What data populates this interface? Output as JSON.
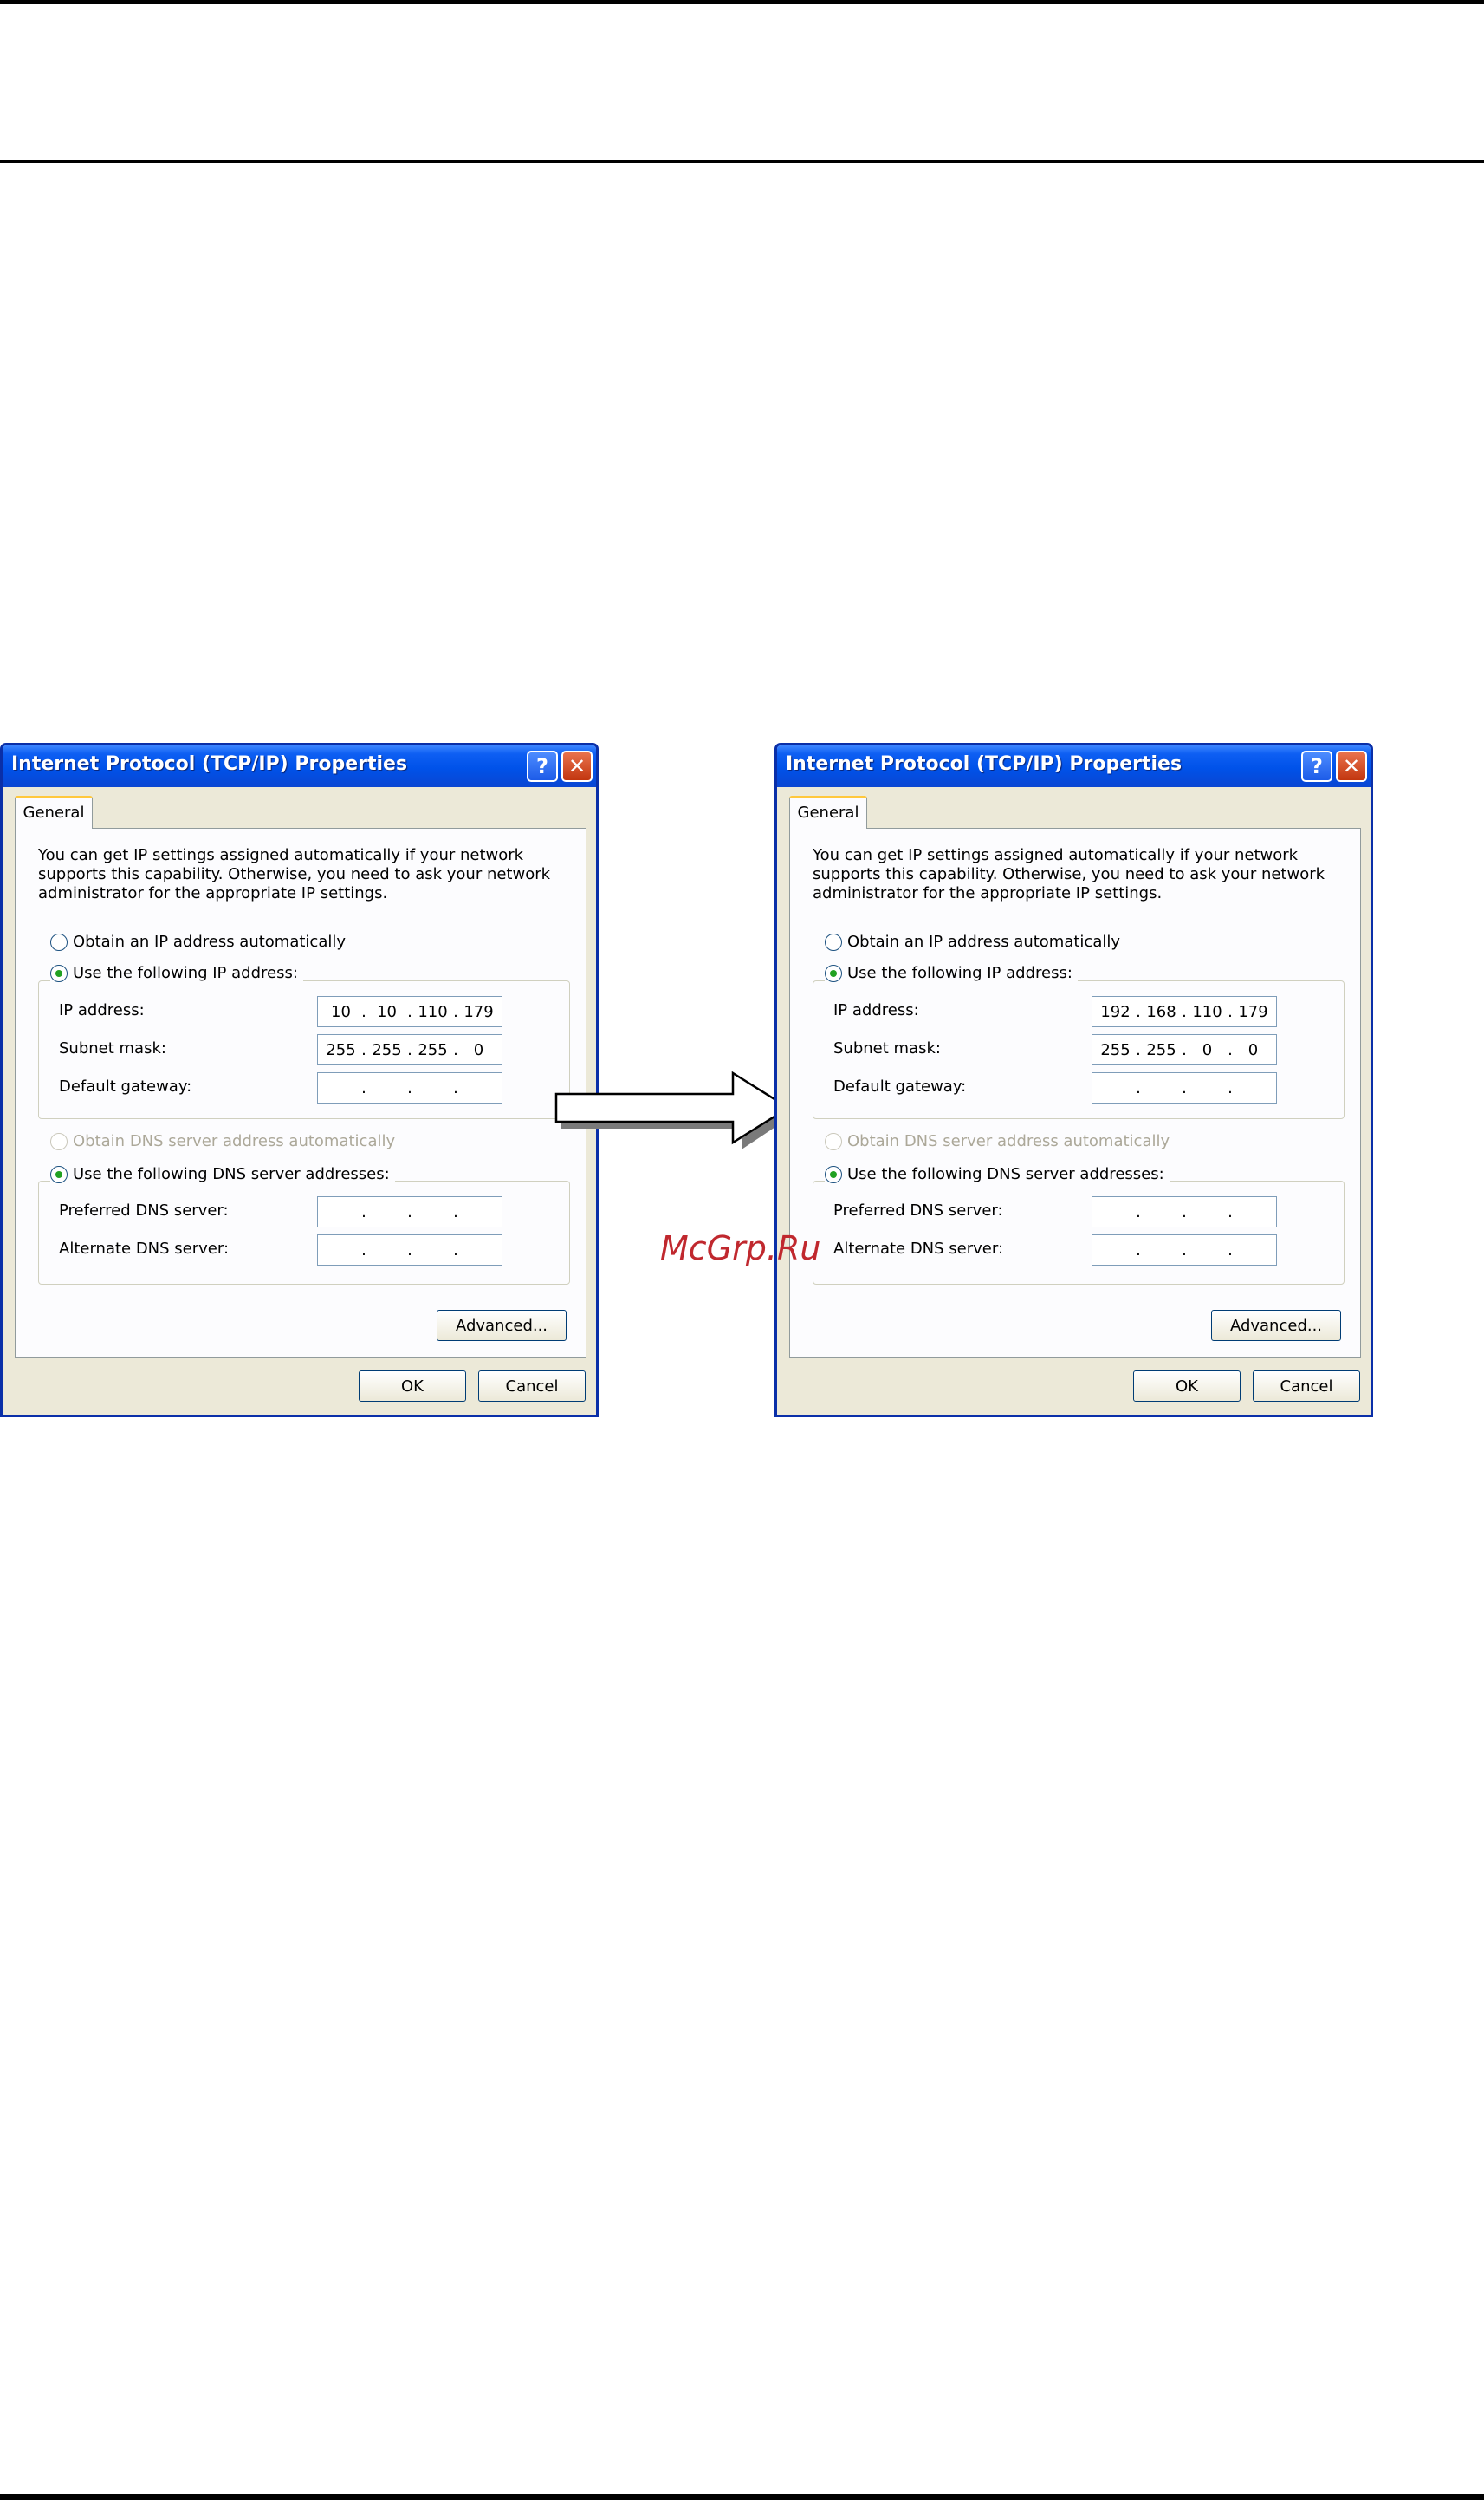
{
  "watermark": "McGrp.Ru",
  "dialogs": [
    {
      "title": "Internet Protocol (TCP/IP) Properties",
      "tab": "General",
      "intro": "You can get IP settings assigned automatically if your network supports this capability. Otherwise, you need to ask your network administrator for the appropriate IP settings.",
      "obtain_ip_auto": "Obtain an IP address automatically",
      "use_following_ip": "Use the following IP address:",
      "ip_address_label": "IP address:",
      "ip_address": [
        "10",
        "10",
        "110",
        "179"
      ],
      "subnet_mask_label": "Subnet mask:",
      "subnet_mask": [
        "255",
        "255",
        "255",
        "0"
      ],
      "default_gateway_label": "Default gateway:",
      "default_gateway": [
        "",
        "",
        "",
        ""
      ],
      "obtain_dns_auto": "Obtain DNS server address automatically",
      "use_following_dns": "Use the following DNS server addresses:",
      "preferred_dns_label": "Preferred DNS server:",
      "preferred_dns": [
        "",
        "",
        "",
        ""
      ],
      "alternate_dns_label": "Alternate DNS server:",
      "alternate_dns": [
        "",
        "",
        "",
        ""
      ],
      "advanced_label": "Advanced...",
      "ok_label": "OK",
      "cancel_label": "Cancel"
    },
    {
      "title": "Internet Protocol (TCP/IP) Properties",
      "tab": "General",
      "intro": "You can get IP settings assigned automatically if your network supports this capability. Otherwise, you need to ask your network administrator for the appropriate IP settings.",
      "obtain_ip_auto": "Obtain an IP address automatically",
      "use_following_ip": "Use the following IP address:",
      "ip_address_label": "IP address:",
      "ip_address": [
        "192",
        "168",
        "110",
        "179"
      ],
      "subnet_mask_label": "Subnet mask:",
      "subnet_mask": [
        "255",
        "255",
        "0",
        "0"
      ],
      "default_gateway_label": "Default gateway:",
      "default_gateway": [
        "",
        "",
        "",
        ""
      ],
      "obtain_dns_auto": "Obtain DNS server address automatically",
      "use_following_dns": "Use the following DNS server addresses:",
      "preferred_dns_label": "Preferred DNS server:",
      "preferred_dns": [
        "",
        "",
        "",
        ""
      ],
      "alternate_dns_label": "Alternate DNS server:",
      "alternate_dns": [
        "",
        "",
        "",
        ""
      ],
      "advanced_label": "Advanced...",
      "ok_label": "OK",
      "cancel_label": "Cancel"
    }
  ]
}
